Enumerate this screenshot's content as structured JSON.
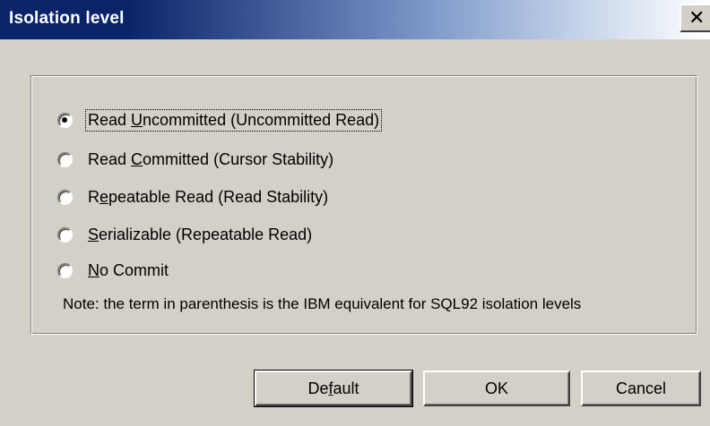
{
  "window": {
    "title": "Isolation level",
    "close_glyph": "✕"
  },
  "options": [
    {
      "pre": "Read ",
      "key": "U",
      "post": "ncommitted (Uncommitted Read)",
      "selected": true
    },
    {
      "pre": "Read ",
      "key": "C",
      "post": "ommitted (Cursor Stability)",
      "selected": false
    },
    {
      "pre": "R",
      "key": "e",
      "post": "peatable Read (Read Stability)",
      "selected": false
    },
    {
      "pre": "",
      "key": "S",
      "post": "erializable (Repeatable Read)",
      "selected": false
    },
    {
      "pre": "",
      "key": "N",
      "post": "o Commit",
      "selected": false
    }
  ],
  "note": "Note: the term in parenthesis is the IBM equivalent for SQL92 isolation levels",
  "buttons": {
    "default": {
      "pre": "De",
      "key": "f",
      "post": "ault"
    },
    "ok": "OK",
    "cancel": "Cancel"
  }
}
